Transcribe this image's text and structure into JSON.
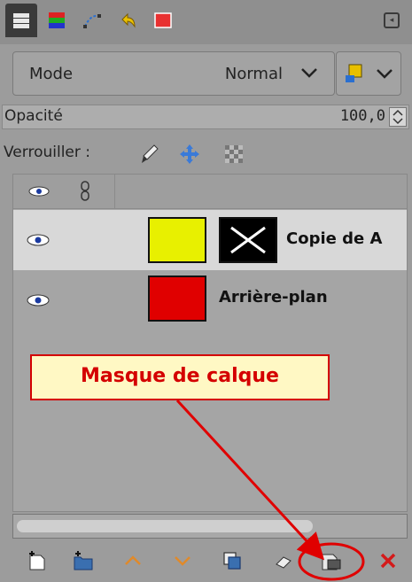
{
  "tabs": [
    {
      "name": "layers-tab-icon"
    },
    {
      "name": "channels-tab-icon"
    },
    {
      "name": "paths-tab-icon"
    },
    {
      "name": "undo-history-tab-icon"
    },
    {
      "name": "colormap-tab-icon"
    }
  ],
  "mode": {
    "label": "Mode",
    "value": "Normal"
  },
  "opacity": {
    "label": "Opacité",
    "value": "100,0"
  },
  "lock": {
    "label": "Verrouiller :"
  },
  "layers": [
    {
      "name": "Copie de A",
      "thumb_color": "#e8f000",
      "has_mask": true,
      "selected": true
    },
    {
      "name": "Arrière-plan",
      "thumb_color": "#e00000",
      "has_mask": false,
      "selected": false
    }
  ],
  "annotation": {
    "label": "Masque de calque",
    "color": "#d40000"
  },
  "colors": {
    "accent_red": "#d40000",
    "panel_bg": "#9c9c9c"
  }
}
